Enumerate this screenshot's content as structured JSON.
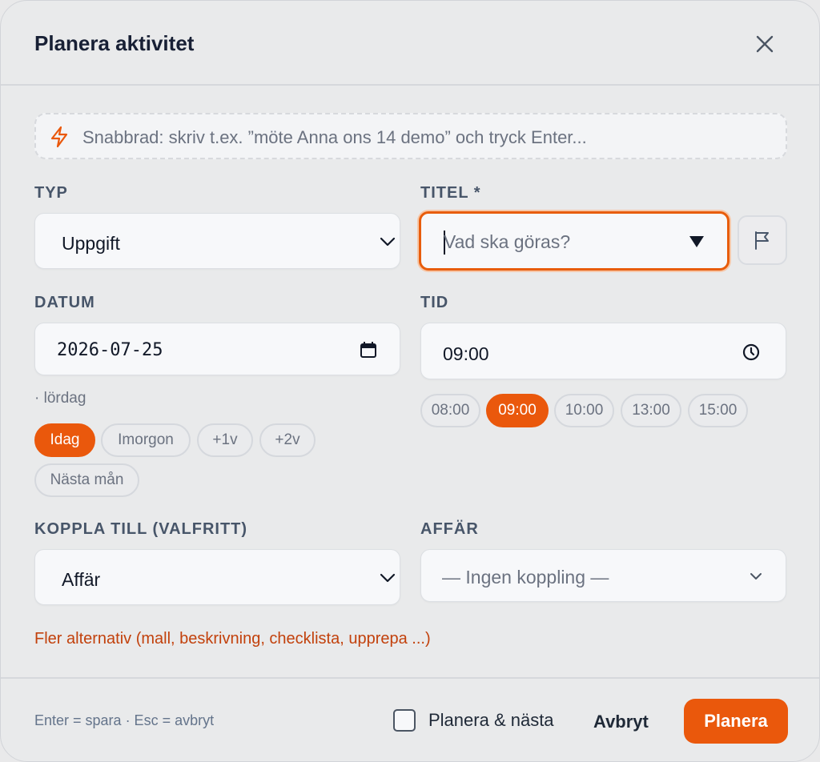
{
  "dialog": {
    "title": "Planera aktivitet",
    "close_icon": "close-icon"
  },
  "quick_entry": {
    "icon": "lightning-icon",
    "placeholder": "Snabbrad: skriv t.ex. ”möte Anna ons 14 demo” och tryck Enter..."
  },
  "type": {
    "label": "TYP",
    "value": "Uppgift"
  },
  "title_field": {
    "label": "TITEL *",
    "placeholder": "Vad ska göras?"
  },
  "date": {
    "label": "DATUM",
    "value": "2026-07-25",
    "weekday": "· lördag",
    "quick_chips": [
      "Idag",
      "Imorgon",
      "+1v",
      "+2v",
      "Nästa mån"
    ],
    "active_chip": "Idag"
  },
  "time": {
    "label": "TID",
    "value": "09:00",
    "quick_chips": [
      "08:00",
      "09:00",
      "10:00",
      "13:00",
      "15:00"
    ],
    "active_chip": "09:00"
  },
  "link": {
    "label": "KOPPLA TILL (VALFRITT)",
    "value": "Affär"
  },
  "deal": {
    "label": "AFFÄR",
    "value": "— Ingen koppling —"
  },
  "more_options": "Fler alternativ (mall, beskrivning, checklista, upprepa ...)",
  "footer": {
    "hint": "Enter = spara · Esc = avbryt",
    "checkbox_label": "Planera & nästa",
    "checkbox_checked": false,
    "cancel_label": "Avbryt",
    "submit_label": "Planera"
  },
  "colors": {
    "accent": "#ea580c",
    "link": "#c2410c",
    "background": "#e9eaeb"
  }
}
